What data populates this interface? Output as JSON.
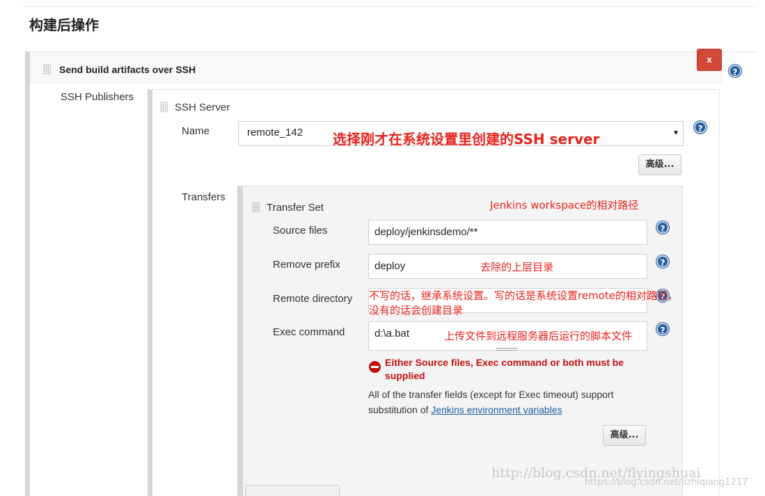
{
  "section_title": "构建后操作",
  "publisher": {
    "title": "Send build artifacts over SSH",
    "delete_label": "x",
    "ssh_publishers_label": "SSH Publishers",
    "ssh_server_label": "SSH Server",
    "name_label": "Name",
    "name_value": "remote_142",
    "advanced_label": "高级...",
    "transfers_label": "Transfers"
  },
  "transfer_set": {
    "title": "Transfer Set",
    "fields": {
      "source_files": {
        "label": "Source files",
        "value": "deploy/jenkinsdemo/**"
      },
      "remove_prefix": {
        "label": "Remove prefix",
        "value": "deploy"
      },
      "remote_directory": {
        "label": "Remote directory",
        "value": ""
      },
      "exec_command": {
        "label": "Exec command",
        "value": "d:\\a.bat"
      }
    },
    "error": "Either Source files, Exec command or both must be supplied",
    "info_prefix": "All of the transfer fields (except for Exec timeout) support substitution of ",
    "info_link": "Jenkins environment variables",
    "advanced_label": "高级..."
  },
  "help_icon_glyph": "?",
  "annotations": {
    "ssh_server_note": "选择刚才在系统设置里创建的SSH server",
    "workspace_note": "Jenkins workspace的相对路径",
    "remove_prefix_note": "去除的上层目录",
    "remote_dir_note_line1": "不写的话，继承系统设置。写的话是系统设置remote的相对路径，",
    "remote_dir_note_line2": "没有的话会创建目录",
    "exec_note": "上传文件到远程服务器后运行的脚本文件"
  },
  "watermarks": {
    "primary": "http://blog.csdn.net/flyingshuai",
    "secondary": "https://blog.csdn.net/lizhiqiang1217"
  },
  "colors": {
    "annotation": "#e8231d",
    "error": "#c30f0f",
    "delete_button": "#d24939",
    "help_icon": "#2a5f9e",
    "link": "#1f5fa6"
  }
}
